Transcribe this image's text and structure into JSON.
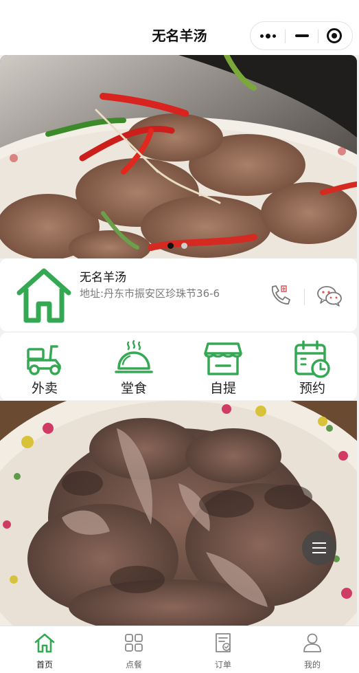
{
  "navbar": {
    "title": "无名羊汤",
    "capsule_icons": [
      "more-dots-icon",
      "minimize-icon",
      "close-target-icon"
    ]
  },
  "banner": {
    "slide_count": 2,
    "active_slide": 1
  },
  "store": {
    "name": "无名羊汤",
    "address": "地址:丹东市振安区珍珠节36-6",
    "logo_icon": "house-icon",
    "phone_icon": "phone-icon",
    "wechat_icon": "wechat-icon"
  },
  "services": [
    {
      "label": "外卖",
      "icon": "scooter-icon"
    },
    {
      "label": "堂食",
      "icon": "food-dome-icon"
    },
    {
      "label": "自提",
      "icon": "storefront-icon"
    },
    {
      "label": "预约",
      "icon": "calendar-clock-icon"
    }
  ],
  "tabs": [
    {
      "label": "首页",
      "icon": "home-icon",
      "active": true
    },
    {
      "label": "点餐",
      "icon": "grid-icon",
      "active": false
    },
    {
      "label": "订单",
      "icon": "order-icon",
      "active": false
    },
    {
      "label": "我的",
      "icon": "user-icon",
      "active": false
    }
  ],
  "colors": {
    "accent": "#35a853",
    "icon_gray": "#888888",
    "background": "#f1f1f1"
  }
}
